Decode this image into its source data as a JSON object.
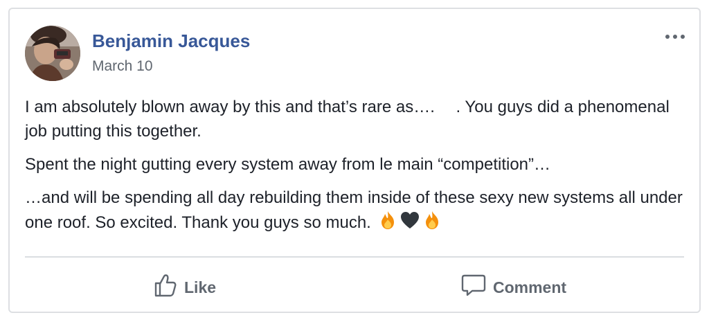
{
  "post": {
    "author": "Benjamin Jacques",
    "date": "March 10",
    "avatar_icon": "profile-photo",
    "more_icon": "more-horizontal-icon",
    "paragraphs": {
      "p1": "I am absolutely blown away by this and that’s rare as….  . You guys did a phenomenal job putting this together.",
      "p2": "Spent the night gutting every system away from le main “competition”…",
      "p3": "…and will be spending all day rebuilding them inside of these sexy new systems all under one roof. So excited. Thank you guys so much."
    },
    "emojis": [
      "fire",
      "black-heart",
      "fire"
    ]
  },
  "actions": {
    "like_label": "Like",
    "comment_label": "Comment",
    "like_icon": "thumbs-up-icon",
    "comment_icon": "speech-bubble-icon"
  },
  "colors": {
    "author_link": "#385898",
    "secondary_text": "#606770",
    "body_text": "#1d2129",
    "border": "#dddfe2"
  }
}
